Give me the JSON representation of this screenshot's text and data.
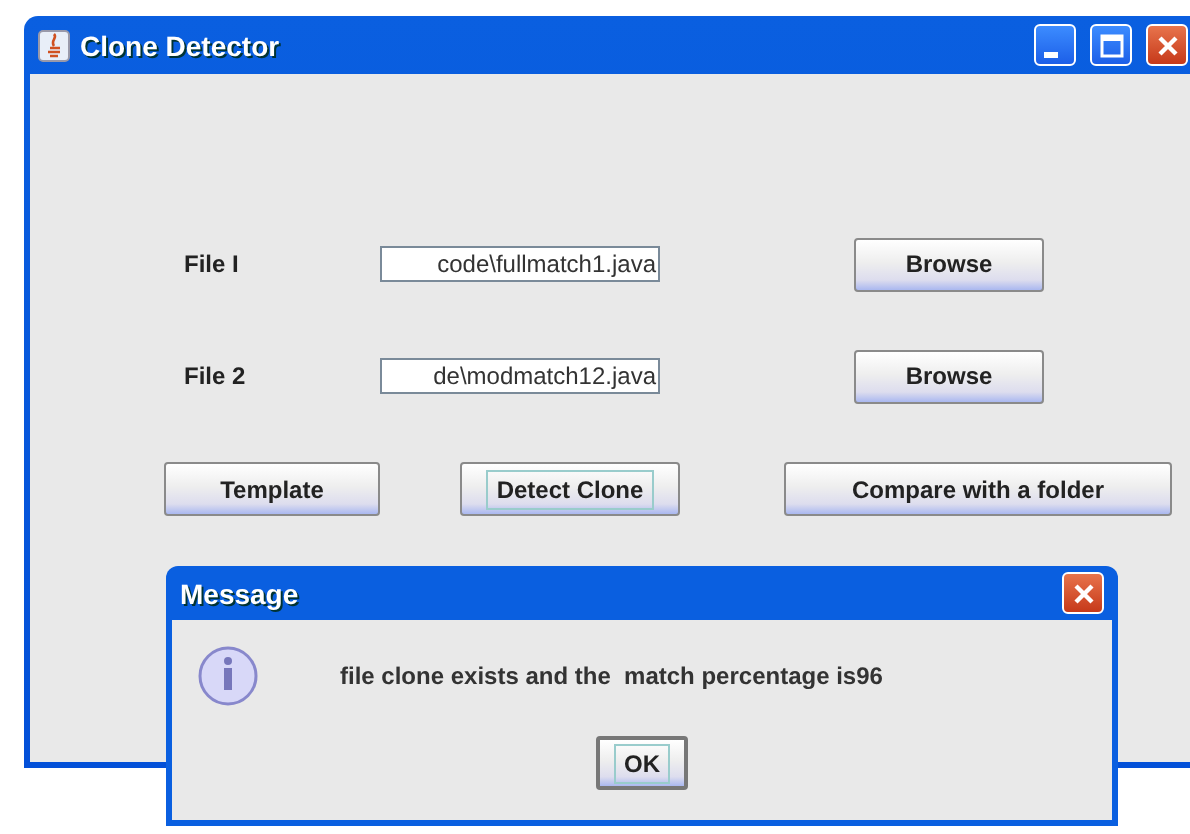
{
  "window": {
    "title": "Clone Detector"
  },
  "file_rows": [
    {
      "label": "File I",
      "value": "code\\fullmatch1.java",
      "button": "Browse"
    },
    {
      "label": "File 2",
      "value": "de\\modmatch12.java",
      "button": "Browse"
    }
  ],
  "actions": [
    {
      "label": "Template",
      "focused": false
    },
    {
      "label": "Detect Clone",
      "focused": true
    },
    {
      "label": "Compare with a folder",
      "focused": false
    }
  ],
  "dialog": {
    "title": "Message",
    "message": "file clone exists and the  match percentage is96",
    "button": {
      "label": "OK",
      "focused": true
    }
  }
}
